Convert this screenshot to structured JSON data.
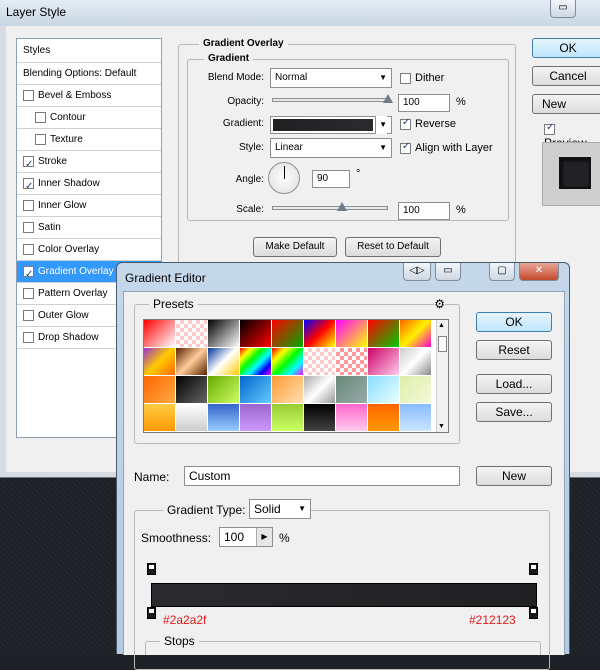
{
  "layer_style": {
    "title": "Layer Style",
    "styles_header": "Styles",
    "items": [
      {
        "label": "Blending Options: Default",
        "checkbox": false,
        "checked": false,
        "indent": false
      },
      {
        "label": "Bevel & Emboss",
        "checkbox": true,
        "checked": false,
        "indent": false
      },
      {
        "label": "Contour",
        "checkbox": true,
        "checked": false,
        "indent": true
      },
      {
        "label": "Texture",
        "checkbox": true,
        "checked": false,
        "indent": true
      },
      {
        "label": "Stroke",
        "checkbox": true,
        "checked": true,
        "indent": false
      },
      {
        "label": "Inner Shadow",
        "checkbox": true,
        "checked": true,
        "indent": false
      },
      {
        "label": "Inner Glow",
        "checkbox": true,
        "checked": false,
        "indent": false
      },
      {
        "label": "Satin",
        "checkbox": true,
        "checked": false,
        "indent": false
      },
      {
        "label": "Color Overlay",
        "checkbox": true,
        "checked": false,
        "indent": false
      },
      {
        "label": "Gradient Overlay",
        "checkbox": true,
        "checked": true,
        "indent": false,
        "selected": true
      },
      {
        "label": "Pattern Overlay",
        "checkbox": true,
        "checked": false,
        "indent": false
      },
      {
        "label": "Outer Glow",
        "checkbox": true,
        "checked": false,
        "indent": false
      },
      {
        "label": "Drop Shadow",
        "checkbox": true,
        "checked": false,
        "indent": false
      }
    ],
    "gradient_overlay": {
      "section_title": "Gradient Overlay",
      "subsection_title": "Gradient",
      "blend_mode_label": "Blend Mode:",
      "blend_mode_value": "Normal",
      "dither_label": "Dither",
      "opacity_label": "Opacity:",
      "opacity_value": "100",
      "opacity_fraction": 1.0,
      "percent": "%",
      "gradient_label": "Gradient:",
      "reverse_label": "Reverse",
      "style_label": "Style:",
      "style_value": "Linear",
      "align_label": "Align with Layer",
      "angle_label": "Angle:",
      "angle_value": "90",
      "degree": "°",
      "scale_label": "Scale:",
      "scale_value": "100",
      "scale_fraction": 0.6,
      "make_default": "Make Default",
      "reset_default": "Reset to Default"
    },
    "buttons": {
      "ok": "OK",
      "cancel": "Cancel",
      "new_style": "New Style...",
      "preview": "Preview"
    }
  },
  "gradient_editor": {
    "title": "Gradient Editor",
    "presets_label": "Presets",
    "buttons": {
      "ok": "OK",
      "reset": "Reset",
      "load": "Load...",
      "save": "Save...",
      "new": "New"
    },
    "name_label": "Name:",
    "name_value": "Custom",
    "gradient_type_label": "Gradient Type:",
    "gradient_type_value": "Solid",
    "smoothness_label": "Smoothness:",
    "smoothness_value": "100",
    "smoothness_unit": "%",
    "left_color": "#2a2a2f",
    "right_color": "#212123",
    "stops_label": "Stops",
    "swatches": [
      "linear-gradient(135deg,#ff0000,#fff)",
      "repeating-conic-gradient(#ffcccc 0 25%,#fff 0 50%) 0 0/8px 8px",
      "linear-gradient(135deg,#000,#fff)",
      "linear-gradient(135deg,#000,#f00)",
      "linear-gradient(135deg,#f00,#0a0)",
      "linear-gradient(135deg,#00f,#f00,#ff0)",
      "linear-gradient(135deg,#f0f,#ff0)",
      "linear-gradient(135deg,#f00,#0c0)",
      "linear-gradient(135deg,#ff6600,#fff200,#ff00cc)",
      "linear-gradient(135deg,#9933cc,#ffcc00,#ff6600)",
      "linear-gradient(135deg,#552200,#ffcc99,#552200)",
      "linear-gradient(135deg,#003399,#fff,#ffcc00)",
      "linear-gradient(135deg,#f00,#ff0,#0f0,#0ff,#00f,#f0f)",
      "linear-gradient(135deg,#f00,#ff0,#0f0,#0ff,#f0f)",
      "repeating-conic-gradient(#ffcccc 0 25%,#fff 0 50%) 0 0/8px 8px",
      "repeating-conic-gradient(#ff9999 0 25%,#fff 0 50%) 0 0/8px 8px",
      "linear-gradient(135deg,#cc0066,#ffccee)",
      "linear-gradient(135deg,#cccccc,#fff,#888)",
      "linear-gradient(135deg,#ff6600,#ffaa44)",
      "linear-gradient(135deg,#000,#666)",
      "linear-gradient(135deg,#66aa00,#ccff66)",
      "linear-gradient(135deg,#0066cc,#66ccff)",
      "linear-gradient(135deg,#ff9933,#ffe0b0)",
      "linear-gradient(135deg,#aaaaaa,#fff,#999)",
      "linear-gradient(135deg,#668877,#99aaaa)",
      "linear-gradient(135deg,#88ddff,#eaffff)",
      "linear-gradient(135deg,#ddeeaa,#f4f8d8)",
      "linear-gradient(#ffcc44,#ff9900)",
      "linear-gradient(#ffffff,#cccccc)",
      "linear-gradient(#3366cc,#99ccff)",
      "linear-gradient(#9966cc,#cc99ff)",
      "linear-gradient(#99cc33,#ccff66)",
      "linear-gradient(#000,#444)",
      "linear-gradient(#ff66cc,#ffccee)",
      "linear-gradient(#ff6600,#ff9900)",
      "linear-gradient(#88bbff,#cce6ff)"
    ]
  }
}
